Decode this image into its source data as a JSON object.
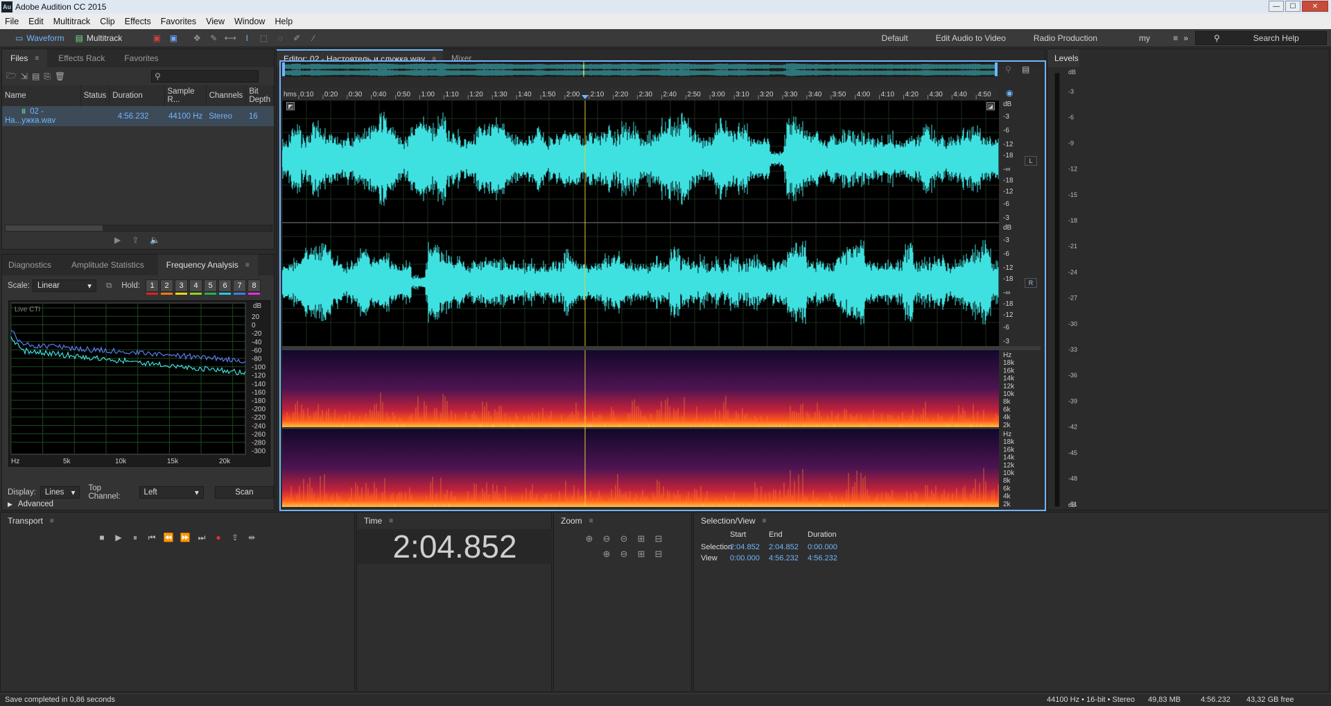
{
  "window": {
    "title": "Adobe Audition CC 2015",
    "logo": "Au",
    "min": "—",
    "max": "☐",
    "close": "✕"
  },
  "menu": [
    "File",
    "Edit",
    "Multitrack",
    "Clip",
    "Effects",
    "Favorites",
    "View",
    "Window",
    "Help"
  ],
  "toolbar": {
    "waveform": "Waveform",
    "multitrack": "Multitrack",
    "workspaces": [
      "Default",
      "Edit Audio to Video",
      "Radio Production",
      "my"
    ],
    "workspace_menu": "≡",
    "more": "»",
    "search_placeholder": "Search Help"
  },
  "files_panel": {
    "tabs": [
      "Files",
      "Effects Rack",
      "Favorites"
    ],
    "columns": [
      "Name",
      "Status",
      "Duration",
      "Sample R...",
      "Channels",
      "Bit Depth"
    ],
    "rows": [
      {
        "name": "02 - На...ужка.wav",
        "status": "",
        "duration": "4:56.232",
        "sample_rate": "44100 Hz",
        "channels": "Stereo",
        "bit_depth": "16"
      }
    ]
  },
  "analysis_panel": {
    "tabs": [
      "Diagnostics",
      "Amplitude Statistics",
      "Frequency Analysis"
    ],
    "scale_label": "Scale:",
    "scale_value": "Linear",
    "hold_label": "Hold:",
    "holds": [
      {
        "n": "1",
        "color": "#e02020"
      },
      {
        "n": "2",
        "color": "#f07a10"
      },
      {
        "n": "3",
        "color": "#e8d814"
      },
      {
        "n": "4",
        "color": "#8fd41c"
      },
      {
        "n": "5",
        "color": "#28b04a"
      },
      {
        "n": "6",
        "color": "#20c8e8"
      },
      {
        "n": "7",
        "color": "#3c7cf0"
      },
      {
        "n": "8",
        "color": "#e030d8"
      }
    ],
    "graph_label": "Live CTI",
    "db_unit": "dB",
    "db_ticks": [
      "20",
      "0",
      "-20",
      "-40",
      "-60",
      "-80",
      "-100",
      "-120",
      "-140",
      "-160",
      "-180",
      "-200",
      "-220",
      "-240",
      "-260",
      "-280",
      "-300"
    ],
    "freq_ticks": [
      "Hz",
      "5k",
      "10k",
      "15k",
      "20k"
    ],
    "display_label": "Display:",
    "display_value": "Lines",
    "top_channel_label": "Top Channel:",
    "top_channel_value": "Left",
    "scan": "Scan",
    "advanced": "Advanced"
  },
  "editor": {
    "tab": "Editor: 02 - Настоятель и служка.wav",
    "mixer": "Mixer",
    "time_ticks": [
      "hms",
      "0:10",
      "0:20",
      "0:30",
      "0:40",
      "0:50",
      "1:00",
      "1:10",
      "1:20",
      "1:30",
      "1:40",
      "1:50",
      "2:00",
      "2:10",
      "2:20",
      "2:30",
      "2:40",
      "2:50",
      "3:00",
      "3:10",
      "3:20",
      "3:30",
      "3:40",
      "3:50",
      "4:00",
      "4:10",
      "4:20",
      "4:30",
      "4:40",
      "4:50"
    ],
    "db_labels": [
      "dB",
      "-3",
      "-6",
      "-12",
      "-18",
      "-∞",
      "-18",
      "-12",
      "-6",
      "-3"
    ],
    "hz_labels": [
      "Hz",
      "18k",
      "16k",
      "14k",
      "12k",
      "10k",
      "8k",
      "6k",
      "4k",
      "2k"
    ],
    "left": "L",
    "right": "R",
    "waveform_color": "#3fe0e0",
    "playhead_color": "#e8d030"
  },
  "levels": {
    "title": "Levels",
    "ticks": [
      "dB",
      "-3",
      "-6",
      "-9",
      "-12",
      "-15",
      "-18",
      "-21",
      "-24",
      "-27",
      "-30",
      "-33",
      "-36",
      "-39",
      "-42",
      "-45",
      "-48",
      "-51",
      "dB"
    ]
  },
  "transport": {
    "title": "Transport"
  },
  "time_panel": {
    "title": "Time",
    "value": "2:04.852"
  },
  "zoom_panel": {
    "title": "Zoom"
  },
  "selection_view": {
    "title": "Selection/View",
    "headers": [
      "Start",
      "End",
      "Duration"
    ],
    "selection_label": "Selection",
    "selection": [
      "2:04.852",
      "2:04.852",
      "0:00.000"
    ],
    "view_label": "View",
    "view": [
      "0:00.000",
      "4:56.232",
      "4:56.232"
    ]
  },
  "status": {
    "message": "Save completed in 0,86 seconds",
    "format": "44100 Hz • 16-bit • Stereo",
    "size": "49,83 MB",
    "duration": "4:56.232",
    "free": "43,32 GB free"
  }
}
